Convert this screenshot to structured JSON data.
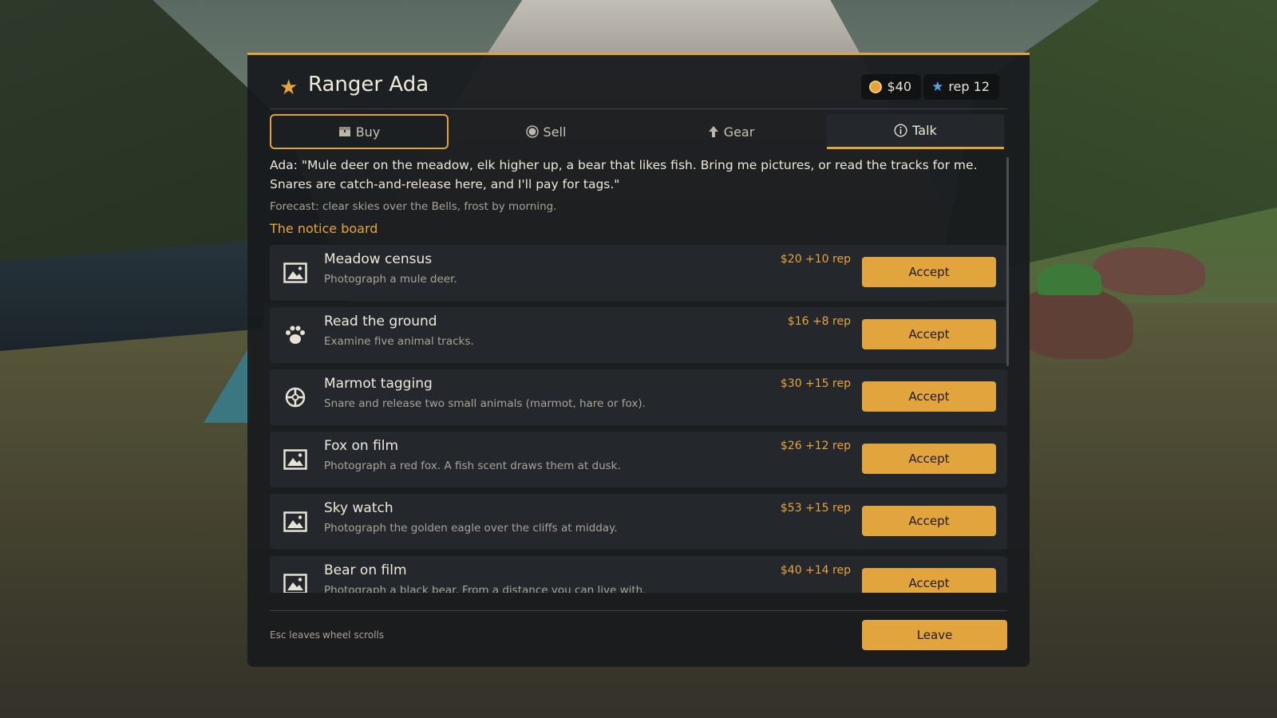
{
  "header": {
    "title": "Ranger Ada",
    "money": "$40",
    "rep": "rep 12"
  },
  "tabs": [
    {
      "label": "Buy",
      "icon": "chest-icon"
    },
    {
      "label": "Sell",
      "icon": "coin-icon"
    },
    {
      "label": "Gear",
      "icon": "arrow-up-icon"
    },
    {
      "label": "Talk",
      "icon": "info-icon"
    }
  ],
  "active_tab": "Talk",
  "dialogue": "Ada: \"Mule deer on the meadow, elk higher up, a bear that likes fish. Bring me pictures, or read the tracks for me. Snares are catch-and-release here, and I'll pay for tags.\"",
  "forecast": "Forecast: clear skies over the Bells, frost by morning.",
  "board_title": "The notice board",
  "jobs": [
    {
      "title": "Meadow census",
      "desc": "Photograph a mule deer.",
      "reward": "$20  +10 rep",
      "icon": "photo-icon",
      "button": "Accept"
    },
    {
      "title": "Read the ground",
      "desc": "Examine five animal tracks.",
      "reward": "$16  +8 rep",
      "icon": "paw-icon",
      "button": "Accept"
    },
    {
      "title": "Marmot tagging",
      "desc": "Snare and release two small animals (marmot, hare or fox).",
      "reward": "$30  +15 rep",
      "icon": "crosshair-icon",
      "button": "Accept"
    },
    {
      "title": "Fox on film",
      "desc": "Photograph a red fox. A fish scent draws them at dusk.",
      "reward": "$26  +12 rep",
      "icon": "photo-icon",
      "button": "Accept"
    },
    {
      "title": "Sky watch",
      "desc": "Photograph the golden eagle over the cliffs at midday.",
      "reward": "$53  +15 rep",
      "icon": "photo-icon",
      "button": "Accept"
    },
    {
      "title": "Bear on film",
      "desc": "Photograph a black bear. From a distance you can live with.",
      "reward": "$40  +14 rep",
      "icon": "photo-icon",
      "button": "Accept"
    }
  ],
  "footer": {
    "hint_esc": "Esc leaves",
    "hint_wheel": "wheel scrolls",
    "leave_label": "Leave"
  },
  "colors": {
    "accent": "#e2a43c",
    "panel": "#181b1e",
    "rep_star": "#5aa0e6"
  }
}
